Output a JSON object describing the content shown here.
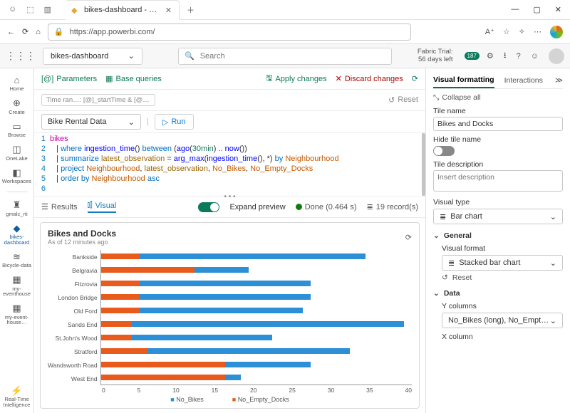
{
  "browser": {
    "tab_title": "bikes-dashboard - Real-Time Int…",
    "url": "https://app.powerbi.com/"
  },
  "apphdr": {
    "workspace": "bikes-dashboard",
    "search_placeholder": "Search",
    "fabric_line1": "Fabric Trial:",
    "fabric_line2": "56 days left",
    "badge": "187"
  },
  "leftrail": {
    "items": [
      "Home",
      "Create",
      "Browse",
      "OneLake",
      "Workspaces",
      "gmalc_rti",
      "bikes-dashboard",
      "Bicycle-data",
      "my-eventhouse",
      "my-event-house…"
    ],
    "bottom": "Real-Time Intelligence"
  },
  "tb": {
    "parameters": "Parameters",
    "base_queries": "Base queries",
    "apply": "Apply changes",
    "discard": "Discard changes"
  },
  "tb2": {
    "timerange": "Time ran…: [@]_startTime  & [@]_endT…",
    "reset": "Reset"
  },
  "tb3": {
    "dataset": "Bike Rental Data",
    "run": "Run"
  },
  "editor": {
    "lines": [
      "1",
      "2",
      "3",
      "4",
      "5",
      "6"
    ]
  },
  "resbar": {
    "results": "Results",
    "visual": "Visual",
    "expand": "Expand preview",
    "done": "Done (0.464 s)",
    "records": "19 record(s)"
  },
  "chart": {
    "title": "Bikes and Docks",
    "subtitle": "As of 12 minutes ago",
    "legend_blue": "No_Bikes",
    "legend_orange": "No_Empty_Docks"
  },
  "rpane": {
    "tab_vf": "Visual formatting",
    "tab_int": "Interactions",
    "collapse": "Collapse all",
    "tile_name": "Tile name",
    "tile_name_val": "Bikes and Docks",
    "hide_tile": "Hide tile name",
    "tile_desc": "Tile description",
    "tile_desc_ph": "Insert description",
    "visual_type": "Visual type",
    "visual_type_val": "Bar chart",
    "general": "General",
    "visual_format": "Visual format",
    "visual_format_val": "Stacked bar chart",
    "reset": "Reset",
    "data": "Data",
    "ycol": "Y columns",
    "ycol_val": "No_Bikes (long), No_Empty_Docks…",
    "xcol": "X column"
  },
  "chart_data": {
    "type": "bar",
    "title": "Bikes and Docks",
    "xlabel": "",
    "ylabel": "",
    "xlim": [
      0,
      40
    ],
    "x_ticks": [
      0,
      5,
      10,
      15,
      20,
      25,
      30,
      35,
      40
    ],
    "categories": [
      "Bankside",
      "Belgravia",
      "Fitzrovia",
      "London Bridge",
      "Old Ford",
      "Sands End",
      "St.John's Wood",
      "Stratford",
      "Wandsworth Road",
      "West End"
    ],
    "series": [
      {
        "name": "No_Empty_Docks",
        "color": "#e85b1c",
        "values": [
          5,
          12,
          5,
          5,
          5,
          4,
          4,
          6,
          16,
          16
        ]
      },
      {
        "name": "No_Bikes",
        "color": "#2d8fd5",
        "values": [
          29,
          7,
          22,
          22,
          21,
          35,
          18,
          26,
          11,
          2
        ]
      }
    ]
  }
}
